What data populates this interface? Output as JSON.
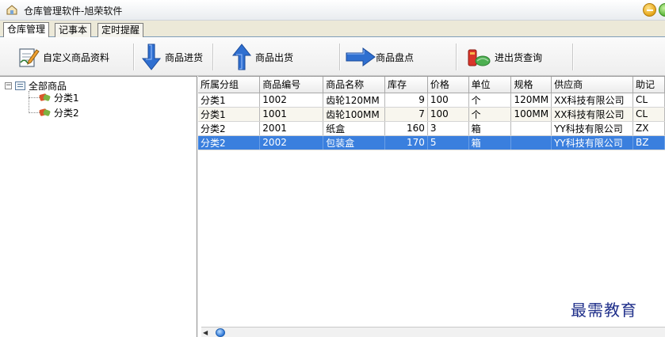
{
  "window": {
    "title": "仓库管理软件-旭荣软件"
  },
  "tabs": [
    {
      "label": "仓库管理"
    },
    {
      "label": "记事本"
    },
    {
      "label": "定时提醒"
    }
  ],
  "toolbar": {
    "buttons": [
      {
        "label": "自定义商品资料",
        "icon": "edit-document-icon"
      },
      {
        "label": "商品进货",
        "icon": "arrow-down-icon"
      },
      {
        "label": "商品出货",
        "icon": "arrow-up-icon"
      },
      {
        "label": "商品盘点",
        "icon": "arrow-right-icon"
      },
      {
        "label": "进出货查询",
        "icon": "search-goods-icon"
      }
    ]
  },
  "tree": {
    "root": {
      "label": "全部商品",
      "expander": "−"
    },
    "children": [
      {
        "label": "分类1"
      },
      {
        "label": "分类2"
      }
    ]
  },
  "grid": {
    "columns": [
      "所属分组",
      "商品编号",
      "商品名称",
      "库存",
      "价格",
      "单位",
      "规格",
      "供应商",
      "助记"
    ],
    "rows": [
      {
        "cells": [
          "分类1",
          "1002",
          "齿轮120MM",
          "9",
          "100",
          "个",
          "120MM",
          "XX科技有限公司",
          "CL"
        ]
      },
      {
        "cells": [
          "分类1",
          "1001",
          "齿轮100MM",
          "7",
          "100",
          "个",
          "100MM",
          "XX科技有限公司",
          "CL"
        ]
      },
      {
        "cells": [
          "分类2",
          "2001",
          "纸盒",
          "160",
          "3",
          "箱",
          "",
          "YY科技有限公司",
          "ZX"
        ]
      },
      {
        "cells": [
          "分类2",
          "2002",
          "包装盒",
          "170",
          "5",
          "箱",
          "",
          "YY科技有限公司",
          "BZ"
        ]
      }
    ],
    "selected_row": 3
  },
  "watermark": "最需教育",
  "colors": {
    "selection": "#3a7fde",
    "tab_border": "#7f9db9"
  }
}
